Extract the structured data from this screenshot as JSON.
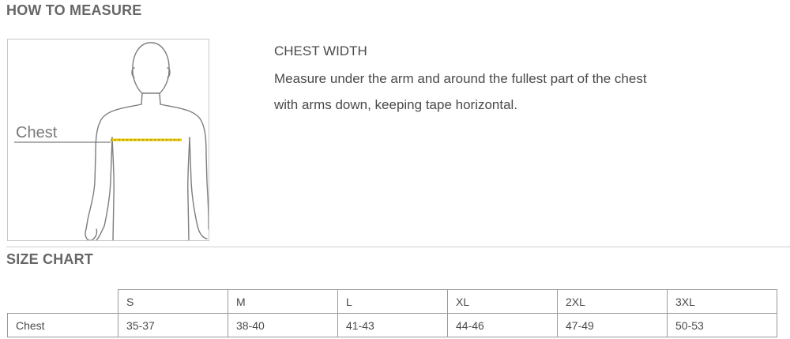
{
  "how_to_measure": {
    "title": "HOW TO MEASURE",
    "figure_label": "Chest",
    "heading": "CHEST WIDTH",
    "lines": [
      "Measure under the arm and around the fullest part of the chest",
      "with arms down, keeping tape horizontal."
    ]
  },
  "size_chart": {
    "title": "SIZE CHART",
    "sizes": [
      "S",
      "M",
      "L",
      "XL",
      "2XL",
      "3XL"
    ],
    "rows": [
      {
        "label": "Chest",
        "values": [
          "35-37",
          "38-40",
          "41-43",
          "44-46",
          "47-49",
          "50-53"
        ]
      }
    ]
  },
  "colors": {
    "tape": "#e8c800",
    "text": "#4a4a4a",
    "border": "#9a9a9a"
  },
  "icons": [
    "body-outline-illustration"
  ]
}
